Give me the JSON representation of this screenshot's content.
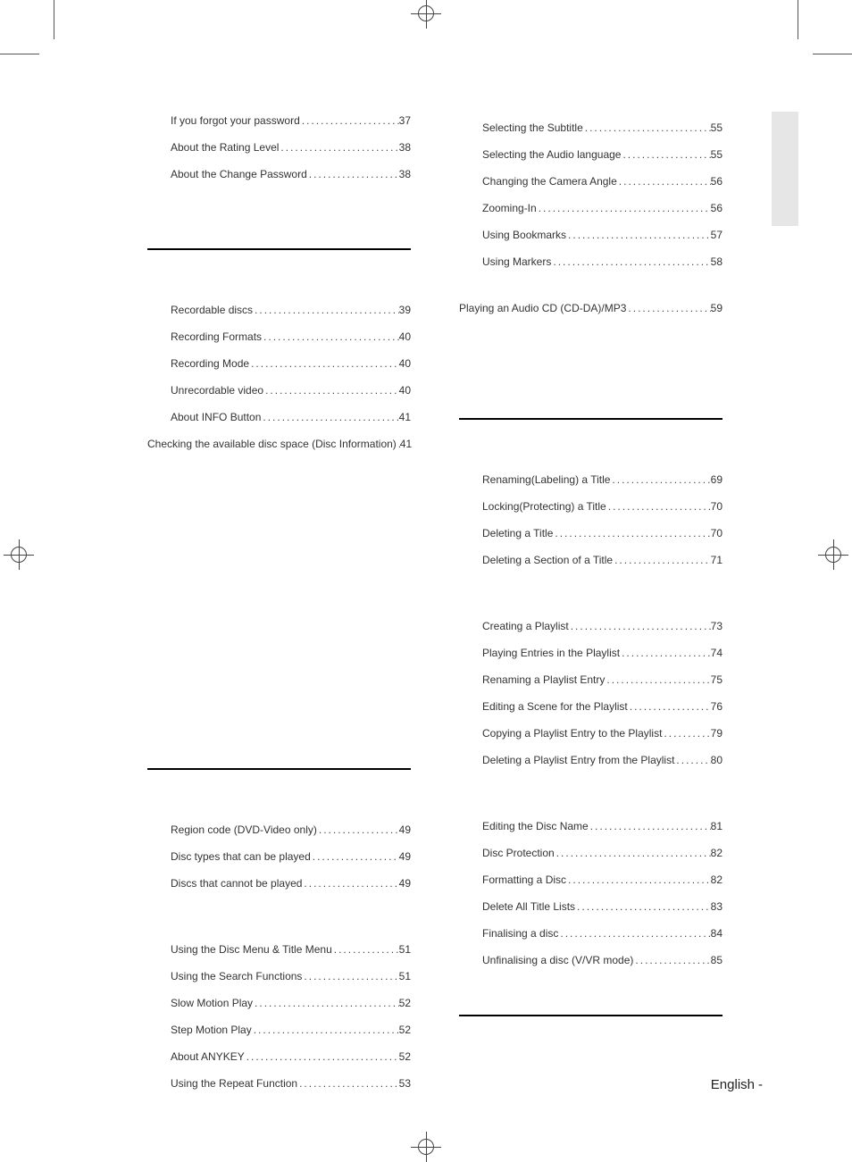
{
  "footer": {
    "label": "English",
    "dash": "-"
  },
  "groups": {
    "left": [
      {
        "leading_rule": false,
        "leading_gap": "",
        "items": [
          {
            "title": "If you forgot your password",
            "page": "37",
            "indent": true
          },
          {
            "title": "About the Rating Level",
            "page": "38",
            "indent": true
          },
          {
            "title": "About the Change Password",
            "page": "38",
            "indent": true
          }
        ],
        "trailing_gap": "spacer-lg"
      },
      {
        "leading_rule": true,
        "leading_gap": "spacer-md",
        "items": [
          {
            "title": "Recordable discs",
            "page": "39",
            "indent": true
          },
          {
            "title": "Recording Formats",
            "page": "40",
            "indent": true
          },
          {
            "title": "Recording Mode",
            "page": "40",
            "indent": true
          },
          {
            "title": "Unrecordable video",
            "page": "40",
            "indent": true
          },
          {
            "title": "About INFO Button",
            "page": "41",
            "indent": true
          },
          {
            "title": "Checking the available disc space (Disc Information)",
            "page": "41",
            "indent": false
          }
        ],
        "trailing_gap": "spacer-big"
      },
      {
        "leading_rule": true,
        "leading_gap": "spacer-md",
        "items": [
          {
            "title": "Region code (DVD-Video only)",
            "page": "49",
            "indent": true
          },
          {
            "title": "Disc types that can be played",
            "page": "49",
            "indent": true
          },
          {
            "title": "Discs that cannot be played",
            "page": "49",
            "indent": true
          }
        ],
        "trailing_gap": "spacer-sm"
      },
      {
        "leading_rule": false,
        "leading_gap": "spacer-sm",
        "items": [
          {
            "title": "Using the Disc Menu & Title Menu",
            "page": "51",
            "indent": true
          },
          {
            "title": "Using the Search Functions",
            "page": "51",
            "indent": true
          },
          {
            "title": "Slow Motion Play",
            "page": "52",
            "indent": true
          },
          {
            "title": "Step Motion Play",
            "page": "52",
            "indent": true
          },
          {
            "title": "About ANYKEY",
            "page": "52",
            "indent": true
          },
          {
            "title": "Using the Repeat Function",
            "page": "53",
            "indent": true
          }
        ],
        "trailing_gap": ""
      }
    ],
    "right": [
      {
        "leading_rule": false,
        "leading_gap": "",
        "items": [
          {
            "title": "Selecting the Subtitle",
            "page": "55",
            "indent": true
          },
          {
            "title": "Selecting the Audio language",
            "page": "55",
            "indent": true
          },
          {
            "title": "Changing the Camera Angle",
            "page": "56",
            "indent": true
          },
          {
            "title": "Zooming-In",
            "page": "56",
            "indent": true
          },
          {
            "title": "Using Bookmarks",
            "page": "57",
            "indent": true
          },
          {
            "title": "Using Markers",
            "page": "58",
            "indent": true
          }
        ],
        "trailing_gap": "spacer-sm"
      },
      {
        "leading_rule": false,
        "leading_gap": "",
        "items": [
          {
            "title": "Playing an Audio CD (CD-DA)/MP3",
            "page": "59",
            "indent": false
          }
        ],
        "trailing_gap": "spacer-bigmid"
      },
      {
        "leading_rule": true,
        "leading_gap": "spacer-md",
        "items": [
          {
            "title": "Renaming(Labeling) a Title",
            "page": "69",
            "indent": true
          },
          {
            "title": "Locking(Protecting) a Title",
            "page": "70",
            "indent": true
          },
          {
            "title": "Deleting a Title",
            "page": "70",
            "indent": true
          },
          {
            "title": "Deleting a Section of a Title",
            "page": "71",
            "indent": true
          }
        ],
        "trailing_gap": "spacer-sm"
      },
      {
        "leading_rule": false,
        "leading_gap": "spacer-sm",
        "items": [
          {
            "title": "Creating a Playlist",
            "page": "73",
            "indent": true
          },
          {
            "title": "Playing Entries in the Playlist",
            "page": "74",
            "indent": true
          },
          {
            "title": "Renaming a Playlist Entry",
            "page": "75",
            "indent": true
          },
          {
            "title": "Editing a Scene for the Playlist",
            "page": "76",
            "indent": true
          },
          {
            "title": "Copying a Playlist Entry to the Playlist",
            "page": "79",
            "indent": true
          },
          {
            "title": "Deleting a Playlist Entry from the Playlist",
            "page": "80",
            "indent": true
          }
        ],
        "trailing_gap": "spacer-sm"
      },
      {
        "leading_rule": false,
        "leading_gap": "spacer-sm",
        "items": [
          {
            "title": "Editing the Disc Name",
            "page": "81",
            "indent": true
          },
          {
            "title": "Disc Protection",
            "page": "82",
            "indent": true
          },
          {
            "title": "Formatting a Disc",
            "page": "82",
            "indent": true
          },
          {
            "title": "Delete All Title Lists",
            "page": "83",
            "indent": true
          },
          {
            "title": "Finalising a disc",
            "page": "84",
            "indent": true
          },
          {
            "title": "Unfinalising a disc (V/VR mode)",
            "page": "85",
            "indent": true
          }
        ],
        "trailing_gap": "spacer-md"
      },
      {
        "leading_rule": true,
        "leading_gap": "",
        "items": [],
        "trailing_gap": ""
      }
    ]
  }
}
